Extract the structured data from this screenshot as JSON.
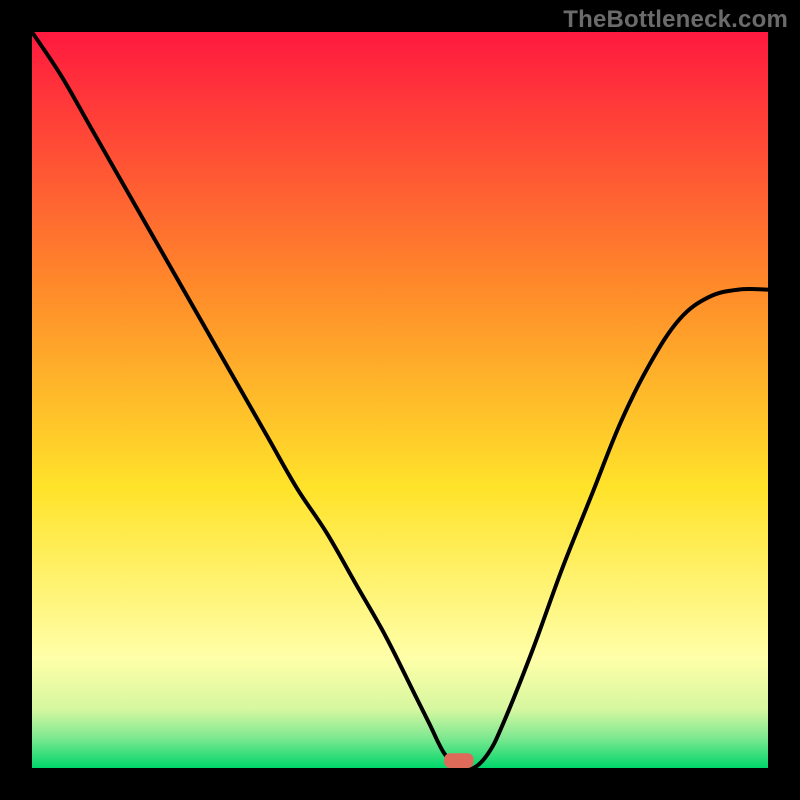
{
  "attribution": "TheBottleneck.com",
  "colors": {
    "top_red": "#ff193f",
    "mid_orange": "#ff8b2a",
    "yellow": "#ffe32a",
    "pale_yellow": "#ffffa8",
    "green_light": "#b6f58a",
    "green": "#00d66a",
    "background": "#000000",
    "curve": "#000000",
    "marker": "#de6a5a"
  },
  "chart_data": {
    "type": "line",
    "title": "",
    "xlabel": "",
    "ylabel": "",
    "xlim": [
      0,
      100
    ],
    "ylim": [
      0,
      100
    ],
    "series": [
      {
        "name": "bottleneck-curve",
        "x": [
          0,
          4,
          8,
          12,
          16,
          20,
          24,
          28,
          32,
          36,
          40,
          44,
          48,
          52,
          54,
          56,
          58,
          60,
          62,
          64,
          68,
          72,
          76,
          80,
          84,
          88,
          92,
          96,
          100
        ],
        "y": [
          100,
          94,
          87,
          80,
          73,
          66,
          59,
          52,
          45,
          38,
          32,
          25,
          18,
          10,
          6,
          2,
          0,
          0,
          2,
          6,
          16,
          27,
          37,
          47,
          55,
          61,
          64,
          65,
          65
        ]
      }
    ],
    "marker": {
      "x": 58,
      "y": 0,
      "width": 4,
      "height": 2
    },
    "gradient_stops": [
      {
        "offset": 0,
        "color": "#ff193f"
      },
      {
        "offset": 35,
        "color": "#ff8b2a"
      },
      {
        "offset": 62,
        "color": "#ffe32a"
      },
      {
        "offset": 85,
        "color": "#ffffa8"
      },
      {
        "offset": 92,
        "color": "#d6f7a0"
      },
      {
        "offset": 96,
        "color": "#7be890"
      },
      {
        "offset": 100,
        "color": "#00d66a"
      }
    ]
  }
}
